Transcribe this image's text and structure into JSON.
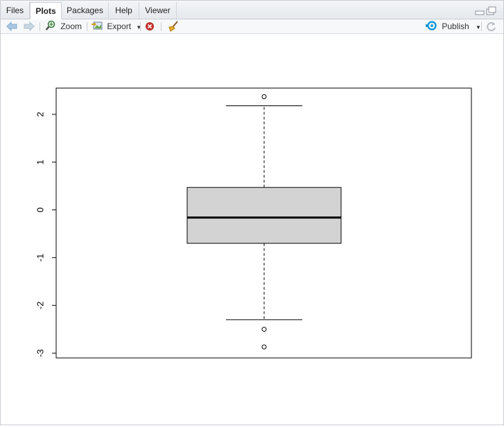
{
  "tabs": [
    {
      "label": "Files",
      "active": false
    },
    {
      "label": "Plots",
      "active": true
    },
    {
      "label": "Packages",
      "active": false
    },
    {
      "label": "Help",
      "active": false
    },
    {
      "label": "Viewer",
      "active": false
    }
  ],
  "toolbar": {
    "back_icon": "arrow-left-icon",
    "forward_icon": "arrow-right-icon",
    "zoom_label": "Zoom",
    "export_label": "Export",
    "remove_icon": "remove-plot-icon",
    "clear_icon": "broom-icon",
    "publish_label": "Publish",
    "refresh_icon": "refresh-icon"
  },
  "colors": {
    "accent_blue": "#1a9bd7",
    "box_fill": "#d3d3d3",
    "remove_red": "#c0332b"
  },
  "chart_data": {
    "type": "boxplot",
    "title": "",
    "xlabel": "",
    "ylabel": "",
    "ylim": [
      -3.1,
      2.55
    ],
    "yticks": [
      -3,
      -2,
      -1,
      0,
      1,
      2
    ],
    "ytick_labels": [
      "-3",
      "-2",
      "-1",
      "0",
      "1",
      "2"
    ],
    "box": {
      "q1": -0.7,
      "median": -0.16,
      "q3": 0.47,
      "whisker_low": -2.3,
      "whisker_high": 2.18,
      "outliers": [
        2.37,
        -2.5,
        -2.87
      ]
    },
    "grid": false,
    "legend": "none"
  }
}
